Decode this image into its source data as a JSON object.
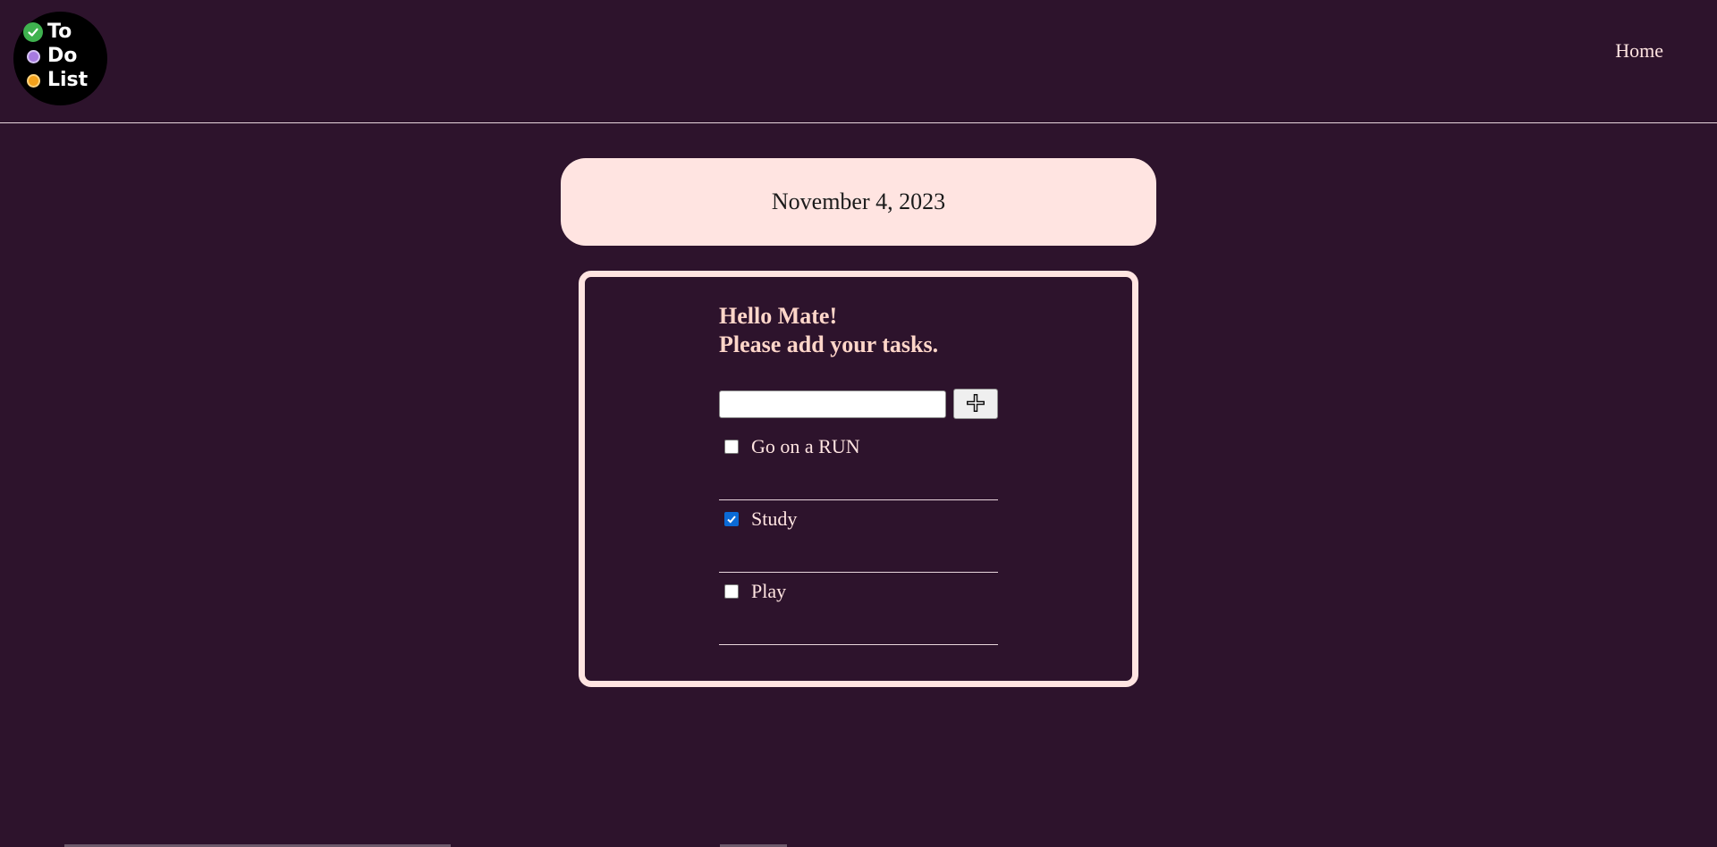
{
  "logo": {
    "line1": "To",
    "line2": "Do",
    "line3": "List",
    "colors": {
      "check": "#3fb24f",
      "purple": "#a77be0",
      "orange": "#f3a11b"
    }
  },
  "nav": {
    "home_label": "Home"
  },
  "date": "November 4, 2023",
  "greeting": {
    "line1": "Hello Mate!",
    "line2": "Please add your tasks."
  },
  "add_task": {
    "input_value": "",
    "button_icon": "plus-icon"
  },
  "tasks": [
    {
      "label": "Go on a RUN",
      "checked": false
    },
    {
      "label": "Study",
      "checked": true
    },
    {
      "label": "Play",
      "checked": false
    }
  ],
  "colors": {
    "background": "#2d132c",
    "card": "#ffe4e1",
    "greeting_text": "#ffd6c9",
    "checkbox_checked": "#0b6ad6"
  }
}
